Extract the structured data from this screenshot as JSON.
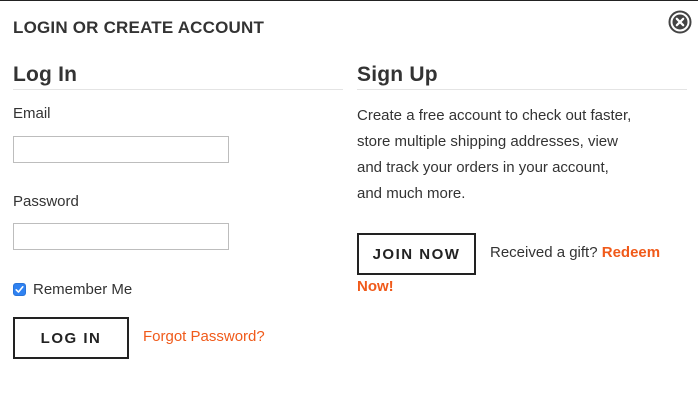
{
  "modal": {
    "title": "LOGIN OR CREATE ACCOUNT",
    "close_icon": "close-circle-icon"
  },
  "login": {
    "heading": "Log In",
    "email_label": "Email",
    "email_value": "",
    "password_label": "Password",
    "password_value": "",
    "remember_label": "Remember Me",
    "remember_checked": true,
    "login_button": "LOG IN",
    "forgot_link": "Forgot Password?"
  },
  "signup": {
    "heading": "Sign Up",
    "description_lines": [
      "Create a free account to check out faster,",
      "store multiple shipping addresses, view",
      "and track your orders in your account,",
      "and much more."
    ],
    "join_button": "JOIN NOW",
    "gift_prompt": "Received a gift?",
    "redeem_link_part1": "Redeem",
    "redeem_link_part2": "Now!"
  },
  "colors": {
    "accent_link": "#f05a1a",
    "checkbox": "#2f82f2",
    "button_border": "#222222"
  }
}
